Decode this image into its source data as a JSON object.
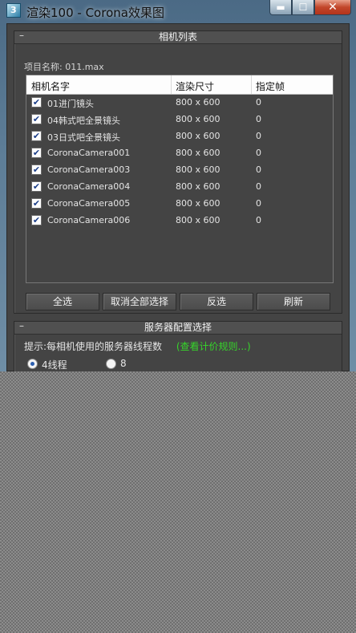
{
  "window": {
    "title": "渲染100 - Corona效果图",
    "minimize_glyph": "▬",
    "maximize_glyph": "☐",
    "close_glyph": "✕"
  },
  "camera_list": {
    "section_title": "相机列表",
    "toggle": "–",
    "project_label": "项目名称: 011.max",
    "columns": [
      "相机名字",
      "渲染尺寸",
      "指定帧"
    ],
    "rows": [
      {
        "name": "01进门镜头",
        "size": "800 x 600",
        "frame": "0",
        "checked": true
      },
      {
        "name": "04韩式吧全景镜头",
        "size": "800 x 600",
        "frame": "0",
        "checked": true
      },
      {
        "name": "03日式吧全景镜头",
        "size": "800 x 600",
        "frame": "0",
        "checked": true
      },
      {
        "name": "CoronaCamera001",
        "size": "800 x 600",
        "frame": "0",
        "checked": true
      },
      {
        "name": "CoronaCamera003",
        "size": "800 x 600",
        "frame": "0",
        "checked": true
      },
      {
        "name": "CoronaCamera004",
        "size": "800 x 600",
        "frame": "0",
        "checked": true
      },
      {
        "name": "CoronaCamera005",
        "size": "800 x 600",
        "frame": "0",
        "checked": true
      },
      {
        "name": "CoronaCamera006",
        "size": "800 x 600",
        "frame": "0",
        "checked": true
      }
    ],
    "check_glyph": "✔",
    "buttons": {
      "select_all": "全选",
      "deselect_all": "取消全部选择",
      "invert": "反选",
      "refresh": "刷新"
    }
  },
  "server_config": {
    "section_title": "服务器配置选择",
    "toggle": "–",
    "hint": "提示:每相机使用的服务器线程数",
    "pricing_link": "(查看计价规则...)",
    "thread_option_selected": "4线程",
    "thread_option_2": "8"
  },
  "colors": {
    "panel_bg": "#444444",
    "link_green": "#36d62a",
    "title_glass": "#5d7d97"
  }
}
